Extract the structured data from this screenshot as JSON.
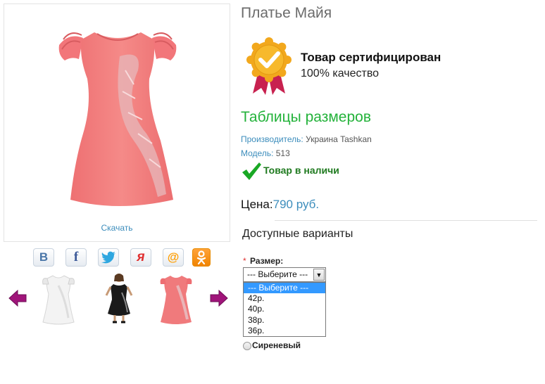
{
  "product": {
    "title": "Платье Майя",
    "download_label": "Скачать",
    "certified_title": "Товар сертифицирован",
    "certified_sub": "100% качество",
    "size_tables_link": "Таблицы размеров",
    "manufacturer_label": "Производитель:",
    "manufacturer_value": "Украина Tashkan",
    "model_label": "Модель:",
    "model_value": "513",
    "stock_status": "Товар в наличи",
    "price_label": "Цена:",
    "price_value": "790 руб."
  },
  "social": [
    {
      "icon": "vk-icon",
      "glyph": "В",
      "color": "#4a76a8"
    },
    {
      "icon": "facebook-icon",
      "glyph": "f",
      "color": "#3b5998"
    },
    {
      "icon": "twitter-icon",
      "glyph": "",
      "color": "#2fa7e0"
    },
    {
      "icon": "moimir-icon",
      "glyph": "я",
      "color": "#e03030"
    },
    {
      "icon": "mailru-icon",
      "glyph": "@",
      "color": "#ff9e00"
    },
    {
      "icon": "odnoklassniki-icon",
      "glyph": "",
      "color": "#ffffff"
    }
  ],
  "thumbnails": [
    "white-dress",
    "black-dress-model",
    "pink-dress"
  ],
  "variants": {
    "title": "Доступные варианты",
    "size_label": "Размер:",
    "required_mark": "*",
    "selected": "--- Выберите ---",
    "options": [
      "--- Выберите ---",
      "42р.",
      "40р.",
      "38р.",
      "36р."
    ],
    "color_option": "Сиреневый"
  },
  "colors": {
    "accent_blue": "#3c8dbc",
    "green": "#23b23a",
    "dress_pink": "#f07a7c",
    "badge_gold": "#f2a81d",
    "ribbon": "#c8214f",
    "arrow_purple": "#a0147a"
  }
}
